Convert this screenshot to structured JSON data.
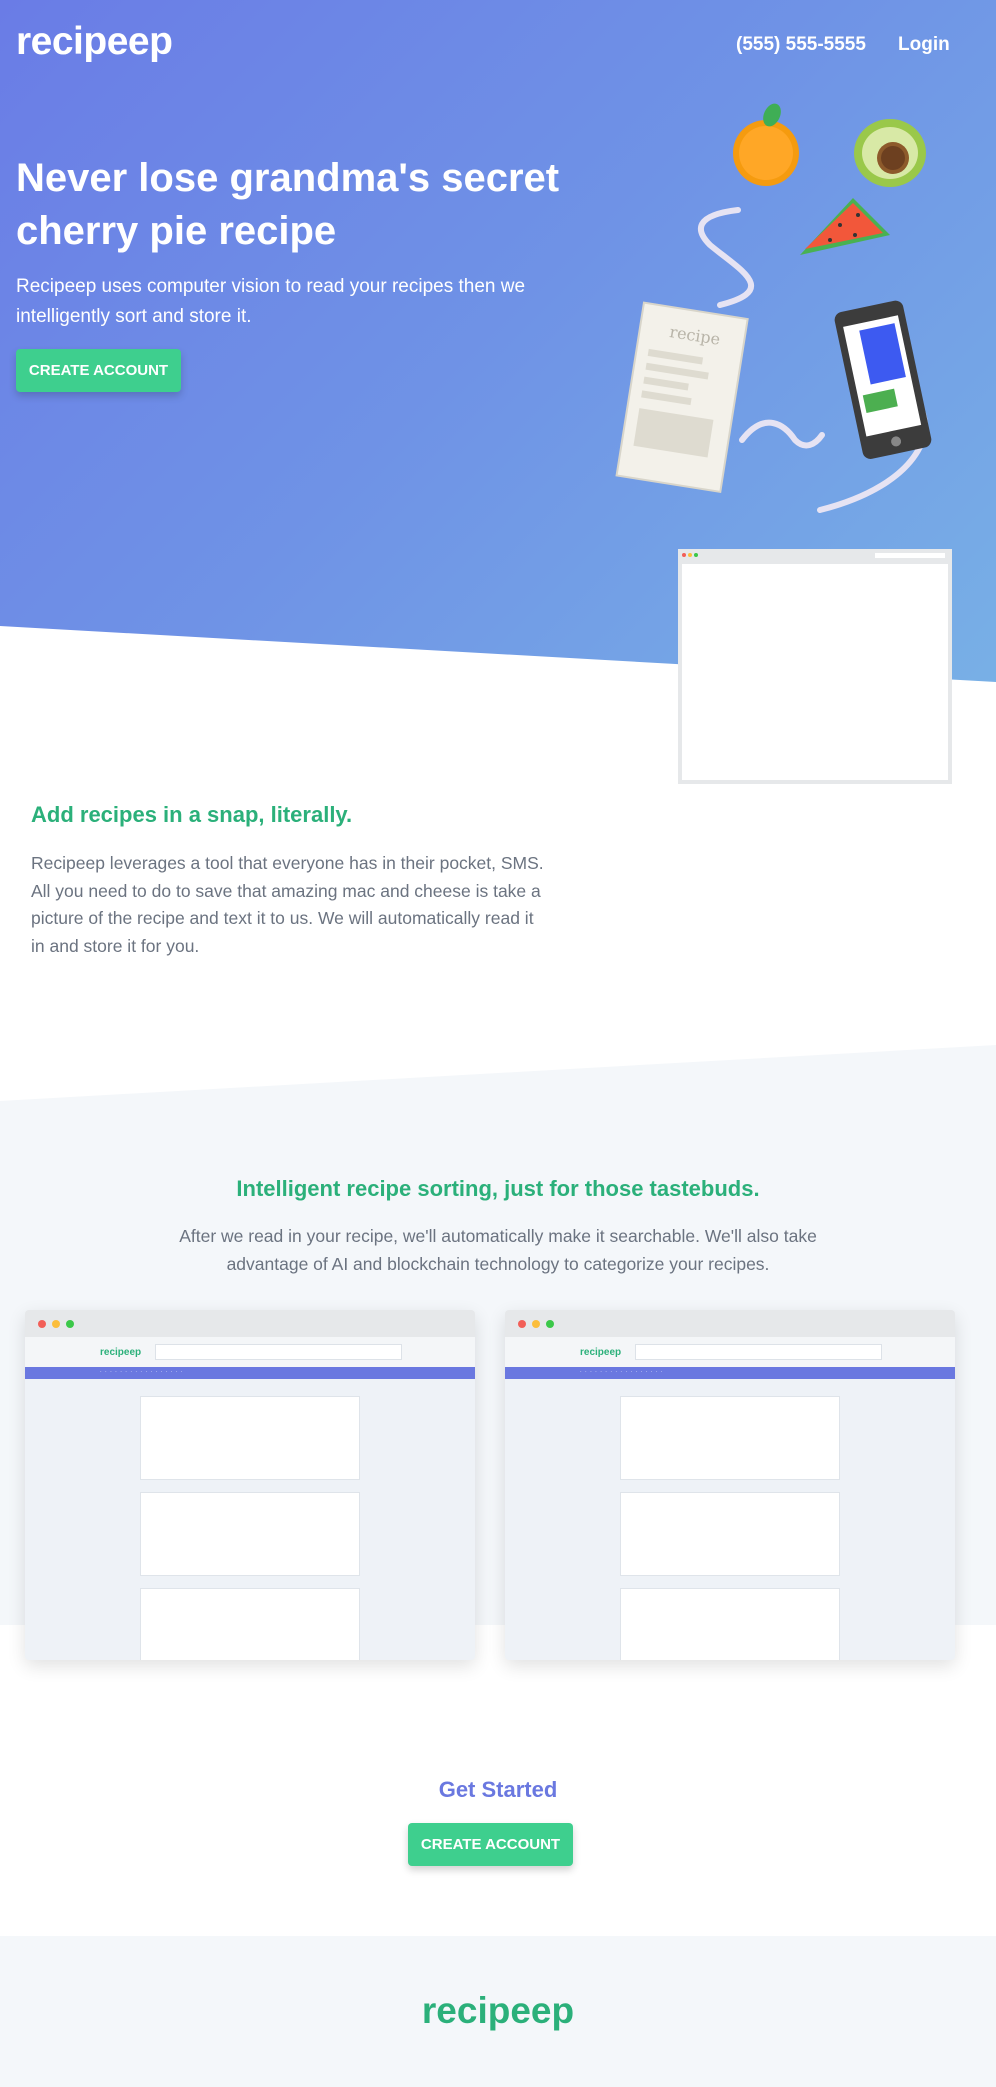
{
  "nav": {
    "logo": "recipeep",
    "phone": "(555) 555-5555",
    "login": "Login"
  },
  "hero": {
    "title": "Never lose grandma's secret cherry pie recipe",
    "subtitle": "Recipeep uses computer vision to read your recipes then we intelligently sort and store it.",
    "cta": "CREATE ACCOUNT",
    "note_label": "recipe"
  },
  "feature_sms": {
    "title": "Add recipes in a snap, literally.",
    "body": "Recipeep leverages a tool that everyone has in their pocket, SMS. All you need to do to save that amazing mac and cheese is take a picture of the recipe and text it to us. We will automatically read it in and store it for you."
  },
  "feature_sort": {
    "title": "Intelligent recipe sorting, just for those tastebuds.",
    "body": "After we read in your recipe, we'll automatically make it searchable. We'll also take advantage of AI and blockchain technology to categorize your recipes.",
    "mock_logo": "recipeep"
  },
  "get_started": {
    "title": "Get Started",
    "cta": "CREATE ACCOUNT"
  },
  "footer": {
    "logo": "recipeep"
  },
  "colors": {
    "accent_green": "#3ecf8e",
    "heading_green": "#2bb07a",
    "brand_blue": "#6a78e0"
  }
}
